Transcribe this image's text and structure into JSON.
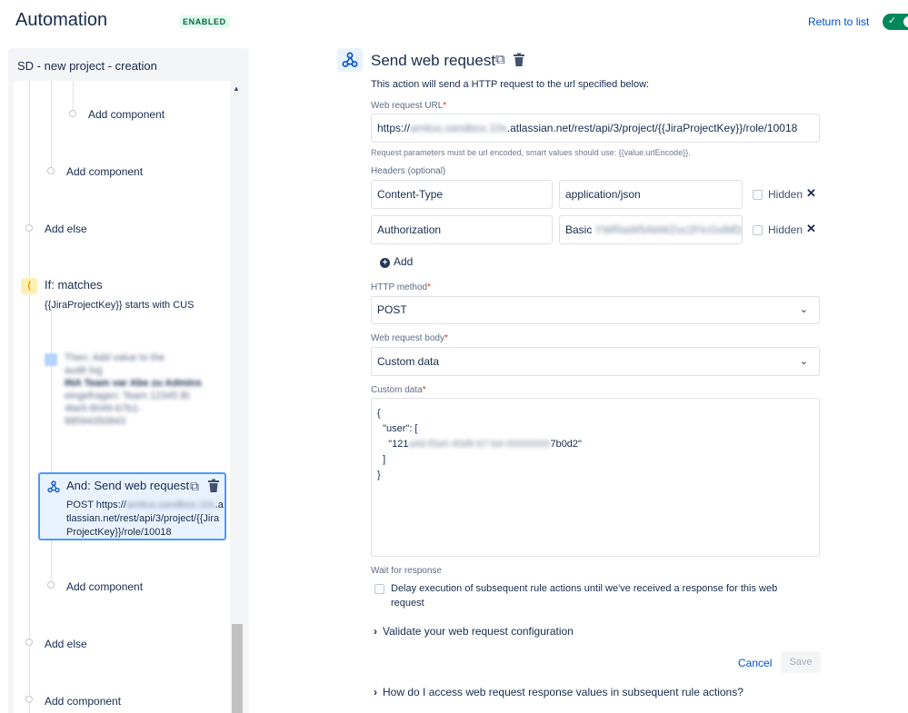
{
  "header": {
    "title": "Automation",
    "status_badge": "ENABLED",
    "return_link": "Return to list",
    "toggle_check": "✓"
  },
  "left_panel": {
    "rule_name": "SD - new project - creation",
    "tree": {
      "add_component_1": "Add component",
      "add_component_2": "Add component",
      "add_else_1": "Add else",
      "if_title": "If: matches",
      "if_desc": "{{JiraProjectKey}} starts with CUS",
      "blurred_lines": [
        "Then: Add value to the",
        "audit log",
        "INA Team var Abe zu Admins",
        "eingefragen: Team 12345 BI",
        "4be5-8049-b7b1-",
        "88594350843"
      ],
      "selected_card": {
        "title": "And: Send web request",
        "body_prefix": "POST https://",
        "body_blur_1": "amitus.sandbox.",
        "body_blur_2": "10x",
        "body_suffix": ".atlassian.net/rest/api/3/project/{{JiraProjectKey}}/role/10018"
      },
      "add_component_3": "Add component",
      "add_else_2": "Add else",
      "add_component_4": "Add component"
    }
  },
  "right_panel": {
    "title": "Send web request",
    "description": "This action will send a HTTP request to the url specified below:",
    "url_label": "Web request URL",
    "url_prefix": "https://",
    "url_blur": "amitus.sandbox.10x",
    "url_suffix": ".atlassian.net/rest/api/3/project/{{JiraProjectKey}}/role/10018",
    "url_help": "Request parameters must be url encoded, smart values should use: {{value.urlEncode}}.",
    "headers_label": "Headers (optional)",
    "headers": [
      {
        "key": "Content-Type",
        "value": "application/json",
        "value_blur": "",
        "hidden_label": "Hidden"
      },
      {
        "key": "Authorization",
        "value": "Basic ",
        "value_blur": "YWRtaW5AbWZoc2FtcGxlMDA0MDE",
        "hidden_label": "Hidden"
      }
    ],
    "add_label": "Add",
    "method_label": "HTTP method",
    "method_value": "POST",
    "body_label": "Web request body",
    "body_value": "Custom data",
    "custom_data_label": "Custom data",
    "custom_data": {
      "line1": "{",
      "line2": "  \"user\": [",
      "line3_prefix": "    \"121",
      "line3_blur": "a4d-f0a4-40d9-b7-bd-00000000",
      "line3_suffix": "7b0d2\"",
      "line4": "  ]",
      "line5": "}"
    },
    "wait_label": "Wait for response",
    "wait_text": "Delay execution of subsequent rule actions until we've received a response for this web request",
    "validate_label": "Validate your web request configuration",
    "cancel_label": "Cancel",
    "save_label": "Save",
    "faq_label": "How do I access web request response values in subsequent rule actions?",
    "required_mark": "*",
    "dropdown_chevron": "⌄",
    "expander_chevron": "›",
    "close_glyph": "✕"
  }
}
